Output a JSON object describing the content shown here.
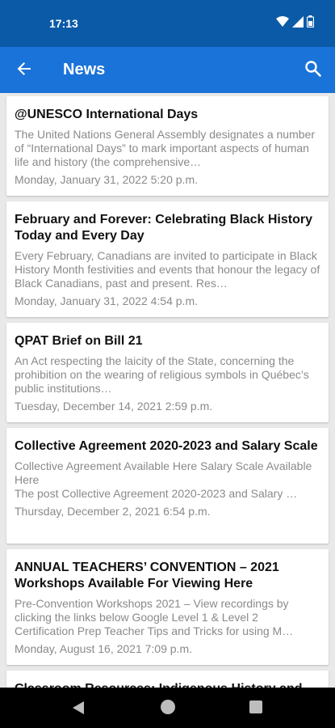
{
  "status_bar": {
    "time": "17:13",
    "icons": [
      "wifi-icon",
      "signal-icon",
      "battery-icon"
    ]
  },
  "app_bar": {
    "title": "News",
    "back_icon": "arrow-left-icon",
    "search_icon": "search-icon",
    "color": "#1a73d9"
  },
  "articles": [
    {
      "title": "@UNESCO International Days",
      "excerpt": "The United Nations General Assembly designates a number of “International Days” to mark important aspects of human life and history (the comprehensive…",
      "date": "Monday, January 31, 2022 5:20 p.m."
    },
    {
      "title": "February and Forever: Celebrating Black History Today and Every Day",
      "excerpt": "Every February, Canadians are invited to participate in Black History Month festivities and events that honour the legacy of Black Canadians, past and present. Res…",
      "date": "Monday, January 31, 2022 4:54 p.m."
    },
    {
      "title": "QPAT Brief on Bill 21",
      "excerpt": "An Act respecting the laicity of the State, concerning the prohibition on the wearing of religious symbols in Québec’s public institutions…",
      "date": "Tuesday, December 14, 2021 2:59 p.m."
    },
    {
      "title": "Collective Agreement 2020-2023 and Salary Scale",
      "excerpt": "Collective Agreement Available Here Salary Scale Available Here\nThe post Collective Agreement 2020-2023 and Salary …",
      "date": "Thursday, December 2, 2021 6:54 p.m."
    },
    {
      "title": "ANNUAL TEACHERS’ CONVENTION – 2021 Workshops Available For Viewing Here",
      "excerpt": "Pre-Convention Workshops 2021 – View recordings by clicking the links below Google Level 1 & Level 2 Certification Prep Teacher Tips and Tricks for using M…",
      "date": "Monday, August 16, 2021 7:09 p.m."
    },
    {
      "title": "Classroom Resources: Indigenous History and",
      "excerpt": "",
      "date": ""
    }
  ],
  "nav_bar": {
    "icons": [
      "nav-back-icon",
      "nav-home-icon",
      "nav-recents-icon"
    ]
  }
}
